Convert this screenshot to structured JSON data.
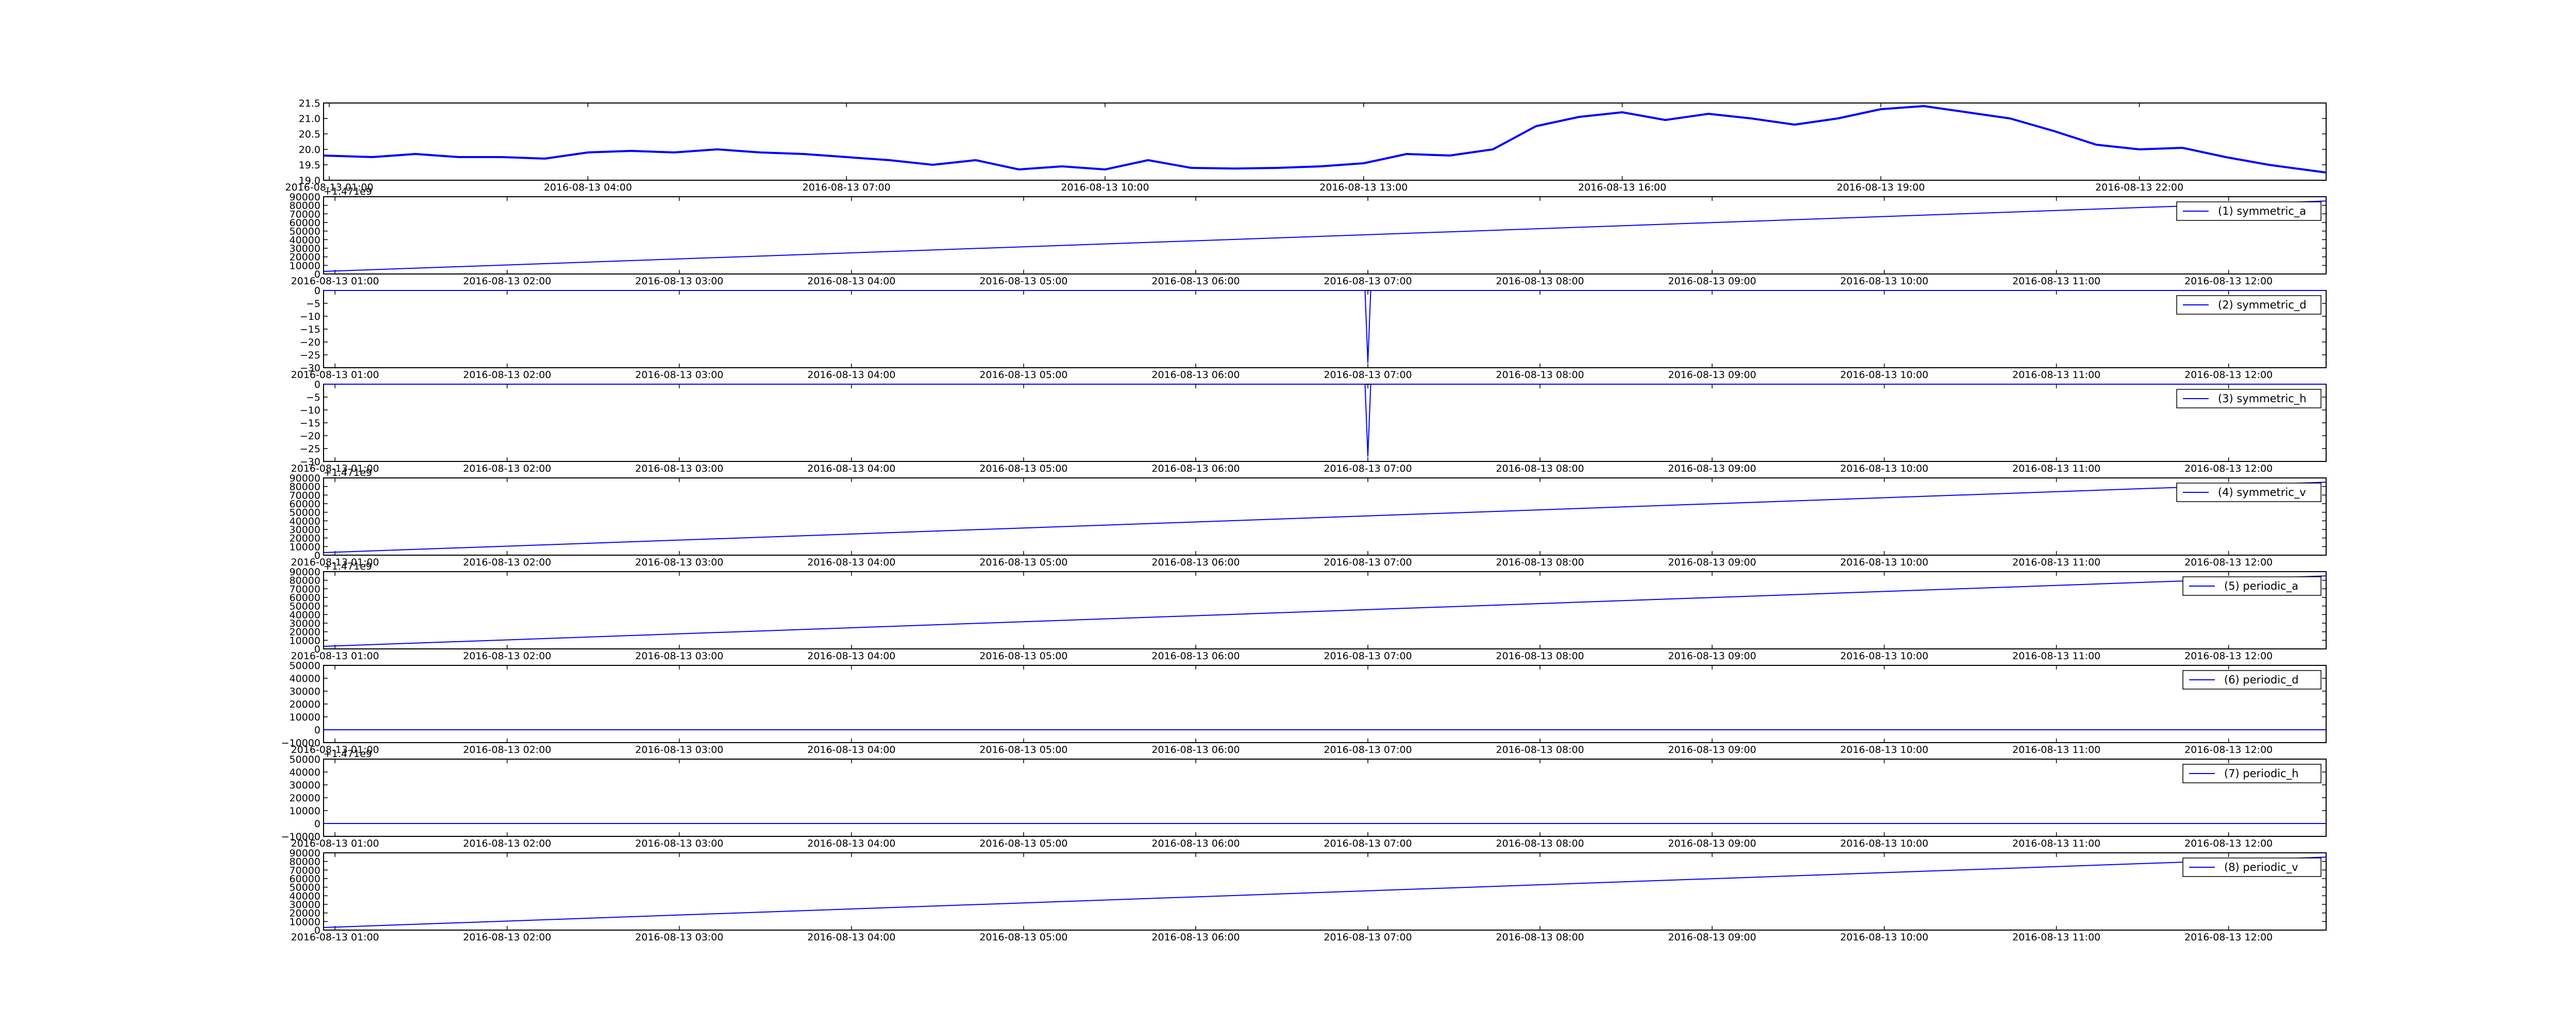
{
  "colors": {
    "line": "#0000ff",
    "axes": "#000000",
    "background": "#ffffff"
  },
  "chart_data": [
    {
      "type": "line",
      "name": "",
      "x_ticks": [
        "2016-08-13 01:00",
        "2016-08-13 04:00",
        "2016-08-13 07:00",
        "2016-08-13 10:00",
        "2016-08-13 13:00",
        "2016-08-13 16:00",
        "2016-08-13 19:00",
        "2016-08-13 22:00"
      ],
      "x_range": [
        "2016-08-13 00:56",
        "2016-08-14 00:10"
      ],
      "ylim": [
        19.0,
        21.5
      ],
      "y_ticks": [
        "19.0",
        "19.5",
        "20.0",
        "20.5",
        "21.0",
        "21.5"
      ],
      "offset_text": "",
      "legend": "",
      "series": [
        {
          "x": [
            "2016-08-13 00:56",
            "2016-08-13 01:30",
            "2016-08-13 02:00",
            "2016-08-13 02:30",
            "2016-08-13 03:00",
            "2016-08-13 03:30",
            "2016-08-13 04:00",
            "2016-08-13 04:30",
            "2016-08-13 05:00",
            "2016-08-13 05:30",
            "2016-08-13 06:00",
            "2016-08-13 06:30",
            "2016-08-13 07:00",
            "2016-08-13 07:30",
            "2016-08-13 08:00",
            "2016-08-13 08:30",
            "2016-08-13 09:00",
            "2016-08-13 09:30",
            "2016-08-13 10:00",
            "2016-08-13 10:30",
            "2016-08-13 11:00",
            "2016-08-13 11:30",
            "2016-08-13 12:00",
            "2016-08-13 12:30",
            "2016-08-13 13:00",
            "2016-08-13 13:30",
            "2016-08-13 14:00",
            "2016-08-13 14:30",
            "2016-08-13 15:00",
            "2016-08-13 15:30",
            "2016-08-13 16:00",
            "2016-08-13 16:30",
            "2016-08-13 17:00",
            "2016-08-13 17:30",
            "2016-08-13 18:00",
            "2016-08-13 18:30",
            "2016-08-13 19:00",
            "2016-08-13 19:30",
            "2016-08-13 20:00",
            "2016-08-13 20:30",
            "2016-08-13 21:00",
            "2016-08-13 21:30",
            "2016-08-13 22:00",
            "2016-08-13 22:30",
            "2016-08-13 23:00",
            "2016-08-13 23:30",
            "2016-08-14 00:10"
          ],
          "y": [
            19.8,
            19.75,
            19.85,
            19.75,
            19.75,
            19.7,
            19.9,
            19.95,
            19.9,
            20.0,
            19.9,
            19.85,
            19.75,
            19.65,
            19.5,
            19.65,
            19.35,
            19.45,
            19.35,
            19.65,
            19.4,
            19.38,
            19.4,
            19.45,
            19.55,
            19.85,
            19.8,
            20.0,
            20.75,
            21.05,
            21.2,
            20.95,
            21.15,
            21.0,
            20.8,
            21.0,
            21.3,
            21.4,
            21.2,
            21.0,
            20.6,
            20.15,
            20.0,
            20.05,
            19.75,
            19.5,
            19.25
          ]
        }
      ]
    },
    {
      "type": "line",
      "name": "symmetric_a",
      "x_ticks": [
        "2016-08-13 01:00",
        "2016-08-13 02:00",
        "2016-08-13 03:00",
        "2016-08-13 04:00",
        "2016-08-13 05:00",
        "2016-08-13 06:00",
        "2016-08-13 07:00",
        "2016-08-13 08:00",
        "2016-08-13 09:00",
        "2016-08-13 10:00",
        "2016-08-13 11:00",
        "2016-08-13 12:00"
      ],
      "x_range": [
        "2016-08-13 00:56",
        "2016-08-13 12:34"
      ],
      "ylim": [
        0,
        90000
      ],
      "y_ticks": [
        "0",
        "10000",
        "20000",
        "30000",
        "40000",
        "50000",
        "60000",
        "70000",
        "80000",
        "90000"
      ],
      "offset_text": "+1.471e9",
      "legend": "(1) symmetric_a",
      "series": [
        {
          "x": [
            "2016-08-13 00:56",
            "2016-08-13 12:34"
          ],
          "y": [
            3000,
            85000
          ]
        }
      ]
    },
    {
      "type": "line",
      "name": "symmetric_d",
      "x_ticks": [
        "2016-08-13 01:00",
        "2016-08-13 02:00",
        "2016-08-13 03:00",
        "2016-08-13 04:00",
        "2016-08-13 05:00",
        "2016-08-13 06:00",
        "2016-08-13 07:00",
        "2016-08-13 08:00",
        "2016-08-13 09:00",
        "2016-08-13 10:00",
        "2016-08-13 11:00",
        "2016-08-13 12:00"
      ],
      "x_range": [
        "2016-08-13 00:56",
        "2016-08-13 12:34"
      ],
      "ylim": [
        -30,
        0
      ],
      "y_ticks": [
        "−30",
        "−25",
        "−20",
        "−15",
        "−10",
        "−5",
        "0"
      ],
      "offset_text": "",
      "legend": "(2) symmetric_d",
      "series": [
        {
          "x": [
            "2016-08-13 00:56",
            "2016-08-13 06:59",
            "2016-08-13 07:00",
            "2016-08-13 07:01",
            "2016-08-13 12:34"
          ],
          "y": [
            0,
            0,
            -28,
            0,
            0
          ]
        }
      ]
    },
    {
      "type": "line",
      "name": "symmetric_h",
      "x_ticks": [
        "2016-08-13 01:00",
        "2016-08-13 02:00",
        "2016-08-13 03:00",
        "2016-08-13 04:00",
        "2016-08-13 05:00",
        "2016-08-13 06:00",
        "2016-08-13 07:00",
        "2016-08-13 08:00",
        "2016-08-13 09:00",
        "2016-08-13 10:00",
        "2016-08-13 11:00",
        "2016-08-13 12:00"
      ],
      "x_range": [
        "2016-08-13 00:56",
        "2016-08-13 12:34"
      ],
      "ylim": [
        -30,
        0
      ],
      "y_ticks": [
        "−30",
        "−25",
        "−20",
        "−15",
        "−10",
        "−5",
        "0"
      ],
      "offset_text": "",
      "legend": "(3) symmetric_h",
      "series": [
        {
          "x": [
            "2016-08-13 00:56",
            "2016-08-13 06:59",
            "2016-08-13 07:00",
            "2016-08-13 07:01",
            "2016-08-13 12:34"
          ],
          "y": [
            0,
            0,
            -28,
            0,
            0
          ]
        }
      ]
    },
    {
      "type": "line",
      "name": "symmetric_v",
      "x_ticks": [
        "2016-08-13 01:00",
        "2016-08-13 02:00",
        "2016-08-13 03:00",
        "2016-08-13 04:00",
        "2016-08-13 05:00",
        "2016-08-13 06:00",
        "2016-08-13 07:00",
        "2016-08-13 08:00",
        "2016-08-13 09:00",
        "2016-08-13 10:00",
        "2016-08-13 11:00",
        "2016-08-13 12:00"
      ],
      "x_range": [
        "2016-08-13 00:56",
        "2016-08-13 12:34"
      ],
      "ylim": [
        0,
        90000
      ],
      "y_ticks": [
        "0",
        "10000",
        "20000",
        "30000",
        "40000",
        "50000",
        "60000",
        "70000",
        "80000",
        "90000"
      ],
      "offset_text": "+1.471e9",
      "legend": "(4) symmetric_v",
      "series": [
        {
          "x": [
            "2016-08-13 00:56",
            "2016-08-13 12:34"
          ],
          "y": [
            3000,
            85000
          ]
        }
      ]
    },
    {
      "type": "line",
      "name": "periodic_a",
      "x_ticks": [
        "2016-08-13 01:00",
        "2016-08-13 02:00",
        "2016-08-13 03:00",
        "2016-08-13 04:00",
        "2016-08-13 05:00",
        "2016-08-13 06:00",
        "2016-08-13 07:00",
        "2016-08-13 08:00",
        "2016-08-13 09:00",
        "2016-08-13 10:00",
        "2016-08-13 11:00",
        "2016-08-13 12:00"
      ],
      "x_range": [
        "2016-08-13 00:56",
        "2016-08-13 12:34"
      ],
      "ylim": [
        0,
        90000
      ],
      "y_ticks": [
        "0",
        "10000",
        "20000",
        "30000",
        "40000",
        "50000",
        "60000",
        "70000",
        "80000",
        "90000"
      ],
      "offset_text": "+1.471e9",
      "legend": "(5) periodic_a",
      "series": [
        {
          "x": [
            "2016-08-13 00:56",
            "2016-08-13 12:34"
          ],
          "y": [
            3000,
            85000
          ]
        }
      ]
    },
    {
      "type": "line",
      "name": "periodic_d",
      "x_ticks": [
        "2016-08-13 01:00",
        "2016-08-13 02:00",
        "2016-08-13 03:00",
        "2016-08-13 04:00",
        "2016-08-13 05:00",
        "2016-08-13 06:00",
        "2016-08-13 07:00",
        "2016-08-13 08:00",
        "2016-08-13 09:00",
        "2016-08-13 10:00",
        "2016-08-13 11:00",
        "2016-08-13 12:00"
      ],
      "x_range": [
        "2016-08-13 00:56",
        "2016-08-13 12:34"
      ],
      "ylim": [
        -10000,
        50000
      ],
      "y_ticks": [
        "−10000",
        "0",
        "10000",
        "20000",
        "30000",
        "40000",
        "50000"
      ],
      "offset_text": "",
      "legend": "(6) periodic_d",
      "series": [
        {
          "x": [
            "2016-08-13 00:56",
            "2016-08-13 12:34"
          ],
          "y": [
            0,
            0
          ]
        }
      ]
    },
    {
      "type": "line",
      "name": "periodic_h",
      "x_ticks": [
        "2016-08-13 01:00",
        "2016-08-13 02:00",
        "2016-08-13 03:00",
        "2016-08-13 04:00",
        "2016-08-13 05:00",
        "2016-08-13 06:00",
        "2016-08-13 07:00",
        "2016-08-13 08:00",
        "2016-08-13 09:00",
        "2016-08-13 10:00",
        "2016-08-13 11:00",
        "2016-08-13 12:00"
      ],
      "x_range": [
        "2016-08-13 00:56",
        "2016-08-13 12:34"
      ],
      "ylim": [
        -10000,
        50000
      ],
      "y_ticks": [
        "−10000",
        "0",
        "10000",
        "20000",
        "30000",
        "40000",
        "50000"
      ],
      "offset_text": "+1.471e9",
      "legend": "(7) periodic_h",
      "series": [
        {
          "x": [
            "2016-08-13 00:56",
            "2016-08-13 12:34"
          ],
          "y": [
            0,
            0
          ]
        }
      ]
    },
    {
      "type": "line",
      "name": "periodic_v",
      "x_ticks": [
        "2016-08-13 01:00",
        "2016-08-13 02:00",
        "2016-08-13 03:00",
        "2016-08-13 04:00",
        "2016-08-13 05:00",
        "2016-08-13 06:00",
        "2016-08-13 07:00",
        "2016-08-13 08:00",
        "2016-08-13 09:00",
        "2016-08-13 10:00",
        "2016-08-13 11:00",
        "2016-08-13 12:00"
      ],
      "x_range": [
        "2016-08-13 00:56",
        "2016-08-13 12:34"
      ],
      "ylim": [
        0,
        90000
      ],
      "y_ticks": [
        "0",
        "10000",
        "20000",
        "30000",
        "40000",
        "50000",
        "60000",
        "70000",
        "80000",
        "90000"
      ],
      "offset_text": "",
      "legend": "(8) periodic_v",
      "series": [
        {
          "x": [
            "2016-08-13 00:56",
            "2016-08-13 12:34"
          ],
          "y": [
            3000,
            85000
          ]
        }
      ]
    }
  ]
}
